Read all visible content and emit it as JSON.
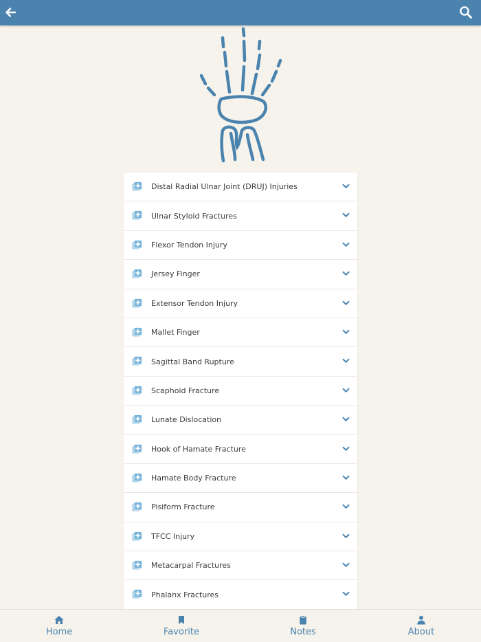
{
  "colors": {
    "primary": "#4a83ae",
    "background": "#f6f3ec",
    "row_icon": "#76b3d8"
  },
  "topbar": {
    "back_icon": "arrow-left-icon",
    "search_icon": "search-icon"
  },
  "logo": {
    "icon": "hand-wrist-bones-icon"
  },
  "list": {
    "items": [
      {
        "label": "Distal Radial Ulnar Joint (DRUJ) Injuries"
      },
      {
        "label": "Ulnar Styloid Fractures"
      },
      {
        "label": "Flexor Tendon Injury"
      },
      {
        "label": "Jersey Finger"
      },
      {
        "label": "Extensor Tendon Injury"
      },
      {
        "label": "Mallet Finger"
      },
      {
        "label": "Sagittal Band Rupture"
      },
      {
        "label": "Scaphoid Fracture"
      },
      {
        "label": "Lunate Dislocation"
      },
      {
        "label": "Hook of Hamate Fracture"
      },
      {
        "label": "Hamate Body Fracture"
      },
      {
        "label": "Pisiform Fracture"
      },
      {
        "label": "TFCC Injury"
      },
      {
        "label": "Metacarpal Fractures"
      },
      {
        "label": "Phalanx Fractures"
      }
    ],
    "item_icon": "add-to-collection-icon",
    "expand_icon": "chevron-down-icon"
  },
  "bottom_nav": {
    "tabs": [
      {
        "label": "Home",
        "icon": "home-icon"
      },
      {
        "label": "Favorite",
        "icon": "bookmark-icon"
      },
      {
        "label": "Notes",
        "icon": "clipboard-icon"
      },
      {
        "label": "About",
        "icon": "user-icon"
      }
    ]
  }
}
